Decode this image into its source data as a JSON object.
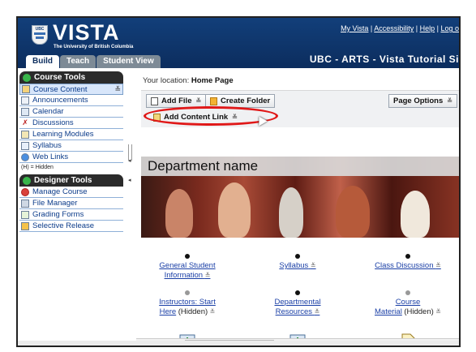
{
  "header": {
    "logo_crest_text": "UBC",
    "logo_title": "VISTA",
    "logo_subtitle": "The University of British Columbia",
    "links": [
      "My Vista",
      "Accessibility",
      "Help",
      "Log o"
    ],
    "course_title": "UBC - ARTS - Vista Tutorial Si",
    "tabs": [
      "Build",
      "Teach",
      "Student View"
    ]
  },
  "course_tools": {
    "title": "Course Tools",
    "items": [
      {
        "label": "Course Content",
        "icon": "folder-icon",
        "active": true
      },
      {
        "label": "Announcements",
        "icon": "megaphone-icon"
      },
      {
        "label": "Calendar",
        "icon": "calendar-icon"
      },
      {
        "label": "Discussions",
        "icon": "discussion-icon"
      },
      {
        "label": "Learning Modules",
        "icon": "module-icon"
      },
      {
        "label": "Syllabus",
        "icon": "syllabus-icon"
      },
      {
        "label": "Web Links",
        "icon": "globe-icon"
      }
    ],
    "hidden_note": "(H) = Hidden"
  },
  "designer_tools": {
    "title": "Designer Tools",
    "items": [
      {
        "label": "Manage Course",
        "icon": "manage-icon"
      },
      {
        "label": "File Manager",
        "icon": "file-manager-icon"
      },
      {
        "label": "Grading Forms",
        "icon": "grading-form-icon"
      },
      {
        "label": "Selective Release",
        "icon": "selective-release-icon"
      }
    ]
  },
  "main": {
    "location_label": "Your location:",
    "location": "Home Page",
    "toolbar": {
      "add_file": "Add File",
      "create_folder": "Create Folder",
      "page_options": "Page Options",
      "add_content_link": "Add Content Link"
    },
    "banner_title": "Department name",
    "content_items": [
      {
        "lines": [
          "General Student",
          "Information"
        ],
        "note": "",
        "dot": "black"
      },
      {
        "lines": [
          "Syllabus"
        ],
        "note": "",
        "dot": "black"
      },
      {
        "lines": [
          "Class Discussion"
        ],
        "note": "",
        "dot": "black"
      },
      {
        "lines": [
          "Instructors: Start",
          "Here"
        ],
        "note": "(Hidden)",
        "dot": "grey"
      },
      {
        "lines": [
          "Departmental",
          "Resources"
        ],
        "note": "",
        "dot": "black"
      },
      {
        "lines": [
          "Course",
          "Material"
        ],
        "note": "(Hidden)",
        "dot": "grey"
      }
    ]
  },
  "colors": {
    "header_blue": "#123f7a",
    "link_blue": "#1a3fa6",
    "highlight_red": "#e01818"
  }
}
